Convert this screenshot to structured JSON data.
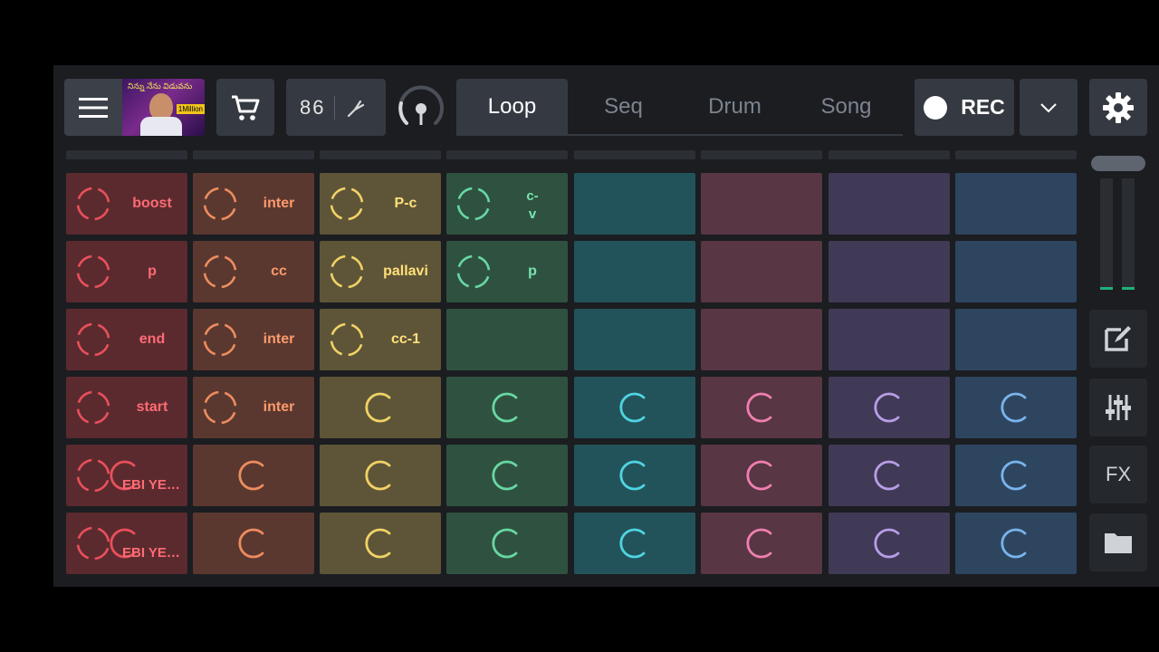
{
  "toolbar": {
    "thumb_title": "నిన్ను నేను విడువను",
    "thumb_badge": "1Million",
    "tempo": "86",
    "tabs": [
      {
        "label": "Loop",
        "active": true
      },
      {
        "label": "Seq",
        "active": false
      },
      {
        "label": "Drum",
        "active": false
      },
      {
        "label": "Song",
        "active": false
      }
    ],
    "rec_label": "REC"
  },
  "sidebar": {
    "fx_label": "FX",
    "edit_icon": "edit-icon",
    "mixer_icon": "sliders-icon",
    "folder_icon": "folder-icon"
  },
  "columns": [
    {
      "bg": "#5b2a2e",
      "accent": "#e8505b",
      "text": "#ff6b74"
    },
    {
      "bg": "#5a382f",
      "accent": "#ee8c5f",
      "text": "#ff9a6c"
    },
    {
      "bg": "#5e5538",
      "accent": "#f1d266",
      "text": "#ffe07a"
    },
    {
      "bg": "#2f5240",
      "accent": "#67d8a3",
      "text": "#78e6b1"
    },
    {
      "bg": "#23535a",
      "accent": "#4fd4e4",
      "text": "#5fe2f0"
    },
    {
      "bg": "#583644",
      "accent": "#ef7fb0",
      "text": "#ff8cbd"
    },
    {
      "bg": "#403a56",
      "accent": "#b99de8",
      "text": "#c6aaf2"
    },
    {
      "bg": "#2e4560",
      "accent": "#79b4ec",
      "text": "#8cc2f6"
    }
  ],
  "rows": [
    [
      {
        "t": "loop",
        "label": "boost"
      },
      {
        "t": "loop",
        "label": "inter"
      },
      {
        "t": "loop",
        "label": "P-c"
      },
      {
        "t": "loop",
        "label": "c-\nv"
      },
      {
        "t": "empty"
      },
      {
        "t": "empty"
      },
      {
        "t": "empty"
      },
      {
        "t": "empty"
      }
    ],
    [
      {
        "t": "loop",
        "label": "p"
      },
      {
        "t": "loop",
        "label": "cc"
      },
      {
        "t": "loop",
        "label": "pallavi"
      },
      {
        "t": "loop",
        "label": "p"
      },
      {
        "t": "empty"
      },
      {
        "t": "empty"
      },
      {
        "t": "empty"
      },
      {
        "t": "empty"
      }
    ],
    [
      {
        "t": "loop",
        "label": "end"
      },
      {
        "t": "loop",
        "label": "inter"
      },
      {
        "t": "loop",
        "label": "cc-1"
      },
      {
        "t": "empty"
      },
      {
        "t": "empty"
      },
      {
        "t": "empty"
      },
      {
        "t": "empty"
      },
      {
        "t": "empty"
      }
    ],
    [
      {
        "t": "loop",
        "label": "start"
      },
      {
        "t": "loop",
        "label": "inter"
      },
      {
        "t": "c"
      },
      {
        "t": "c"
      },
      {
        "t": "c"
      },
      {
        "t": "c"
      },
      {
        "t": "c"
      },
      {
        "t": "c"
      }
    ],
    [
      {
        "t": "loopc",
        "label": "EBI YEPUGU"
      },
      {
        "t": "c"
      },
      {
        "t": "c"
      },
      {
        "t": "c"
      },
      {
        "t": "c"
      },
      {
        "t": "c"
      },
      {
        "t": "c"
      },
      {
        "t": "c"
      }
    ],
    [
      {
        "t": "loopc",
        "label": "EBI YEPUGU"
      },
      {
        "t": "c"
      },
      {
        "t": "c"
      },
      {
        "t": "c"
      },
      {
        "t": "c"
      },
      {
        "t": "c"
      },
      {
        "t": "c"
      },
      {
        "t": "c"
      }
    ]
  ]
}
